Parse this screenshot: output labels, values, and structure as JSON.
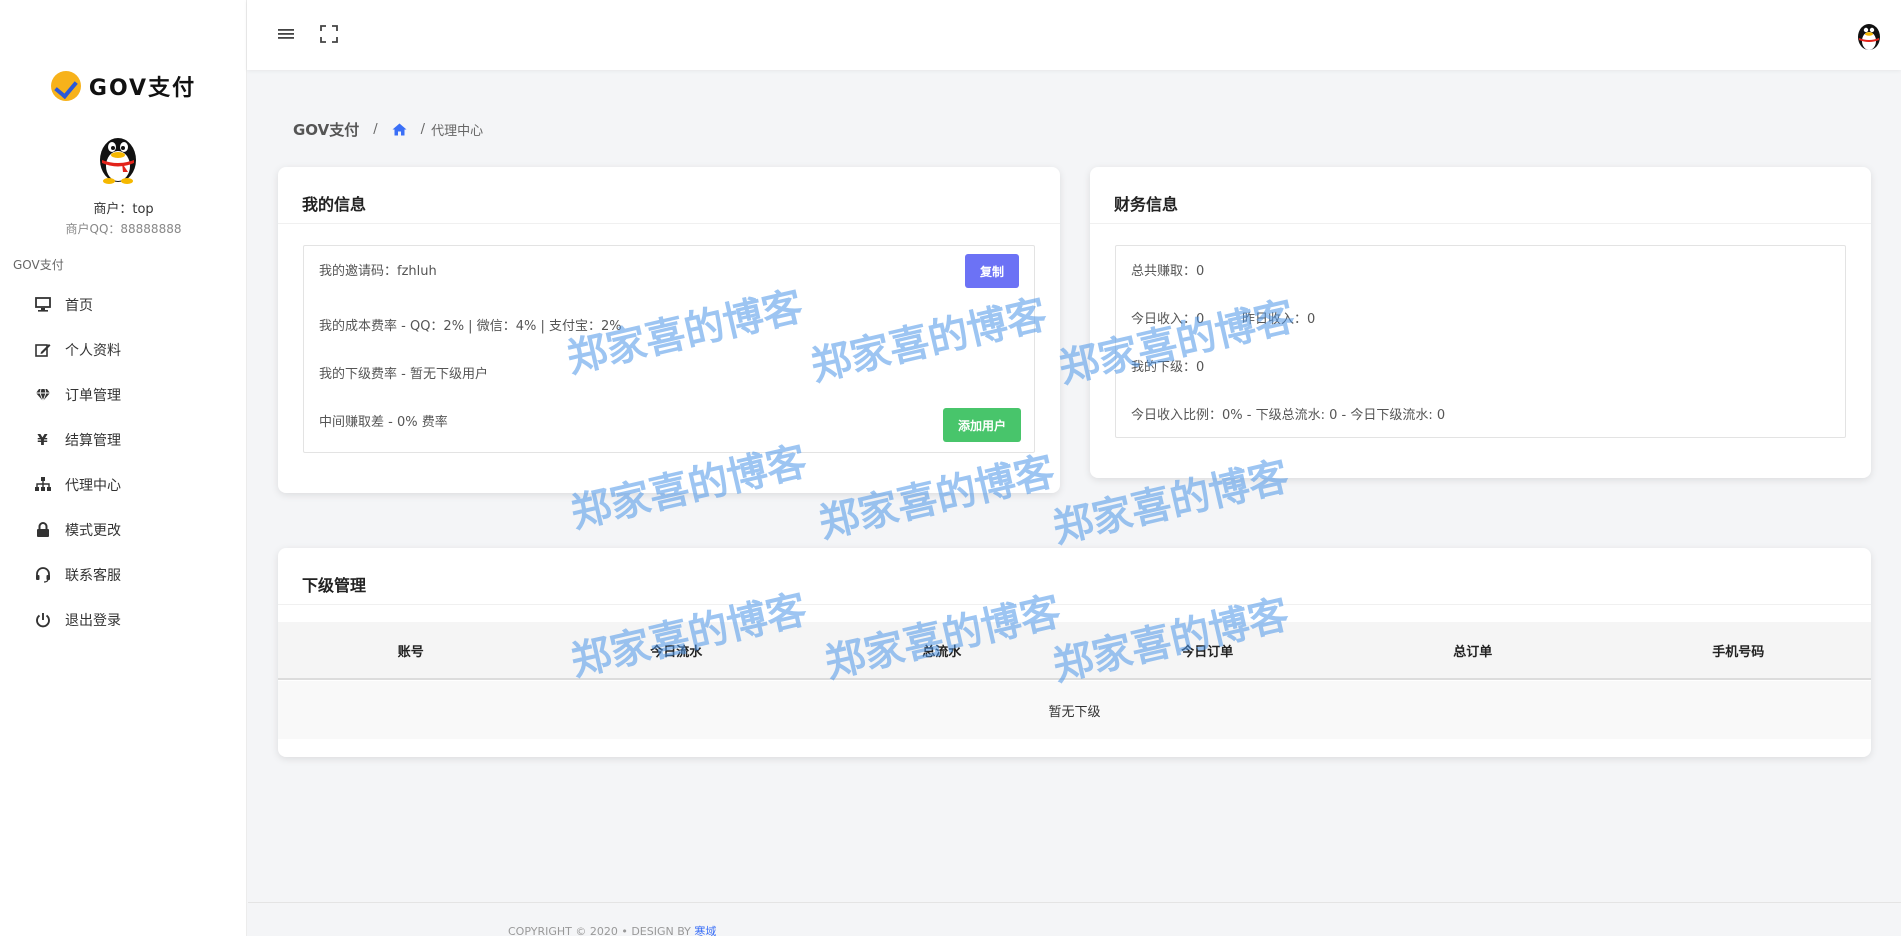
{
  "brand": {
    "name": "GOV支付"
  },
  "profile": {
    "merchant": "商户：top",
    "qq": "商户QQ：88888888"
  },
  "sidebar": {
    "section": "GOV支付",
    "items": [
      {
        "label": "首页",
        "icon": "monitor-icon"
      },
      {
        "label": "个人资料",
        "icon": "edit-icon"
      },
      {
        "label": "订单管理",
        "icon": "diamond-icon"
      },
      {
        "label": "结算管理",
        "icon": "yen-icon"
      },
      {
        "label": "代理中心",
        "icon": "sitemap-icon"
      },
      {
        "label": "模式更改",
        "icon": "lock-icon"
      },
      {
        "label": "联系客服",
        "icon": "headset-icon"
      },
      {
        "label": "退出登录",
        "icon": "power-icon"
      }
    ]
  },
  "breadcrumb": {
    "brand": "GOV支付",
    "sep": "/",
    "current": "代理中心"
  },
  "my_info": {
    "title": "我的信息",
    "invite": "我的邀请码：fzhluh",
    "cost_rate": "我的成本费率 - QQ：2% | 微信：4% | 支付宝：2%",
    "sub_rate": "我的下级费率 - 暂无下级用户",
    "margin": "中间赚取差 - 0% 费率",
    "copy_button": "复制",
    "add_user_button": "添加用户"
  },
  "finance": {
    "title": "财务信息",
    "total": "总共赚取：0",
    "today": "今日收入：0",
    "yesterday": "昨日收入：0",
    "subordinates": "我的下级：0",
    "ratio": "今日收入比例：0% - 下级总流水: 0 - 今日下级流水: 0"
  },
  "sub_management": {
    "title": "下级管理",
    "columns": [
      "账号",
      "今日流水",
      "总流水",
      "今日订单",
      "总订单",
      "手机号码"
    ],
    "empty": "暂无下级"
  },
  "footer": {
    "text": "COPYRIGHT © 2020  •  DESIGN BY",
    "link": "寒域"
  },
  "watermark": "郑家喜的博客",
  "colors": {
    "copy_button": "#6c72f5",
    "add_button": "#48c56b",
    "watermark": "#4d96e8"
  }
}
